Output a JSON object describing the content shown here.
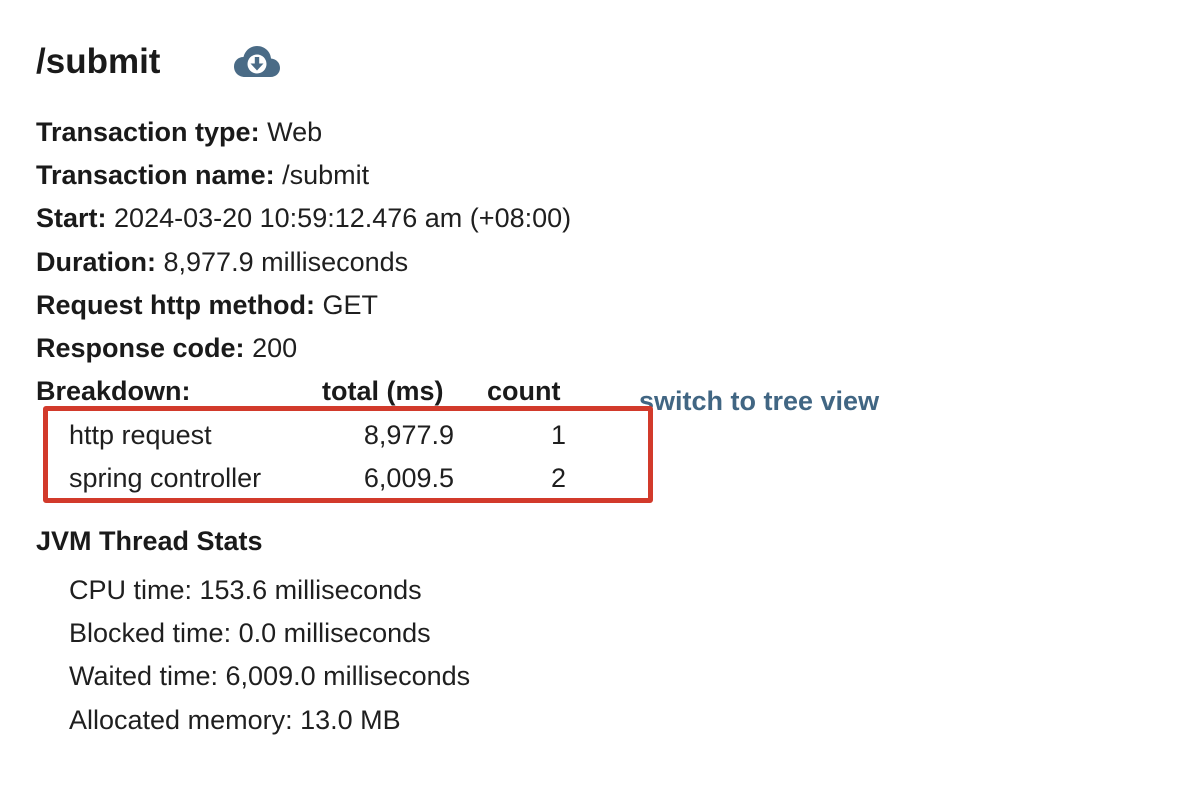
{
  "header": {
    "title": "/submit",
    "download_icon": "cloud-download-icon",
    "icon_color": "#4a6b86"
  },
  "details": [
    {
      "label": "Transaction type:",
      "value": "Web"
    },
    {
      "label": "Transaction name:",
      "value": "/submit"
    },
    {
      "label": "Start:",
      "value": "2024-03-20 10:59:12.476 am (+08:00)"
    },
    {
      "label": "Duration:",
      "value": "8,977.9 milliseconds"
    },
    {
      "label": "Request http method:",
      "value": "GET"
    },
    {
      "label": "Response code:",
      "value": "200"
    }
  ],
  "breakdown": {
    "label": "Breakdown:",
    "columns": {
      "total": "total (ms)",
      "count": "count"
    },
    "rows": [
      {
        "name": "http request",
        "total": "8,977.9",
        "count": "1"
      },
      {
        "name": "spring controller",
        "total": "6,009.5",
        "count": "2"
      }
    ],
    "switch_link": "switch to tree view",
    "link_color": "#416683",
    "highlight_color": "#d23a2b"
  },
  "jvm": {
    "heading": "JVM Thread Stats",
    "stats": [
      "CPU time: 153.6 milliseconds",
      "Blocked time: 0.0 milliseconds",
      "Waited time: 6,009.0 milliseconds",
      "Allocated memory: 13.0 MB"
    ]
  }
}
